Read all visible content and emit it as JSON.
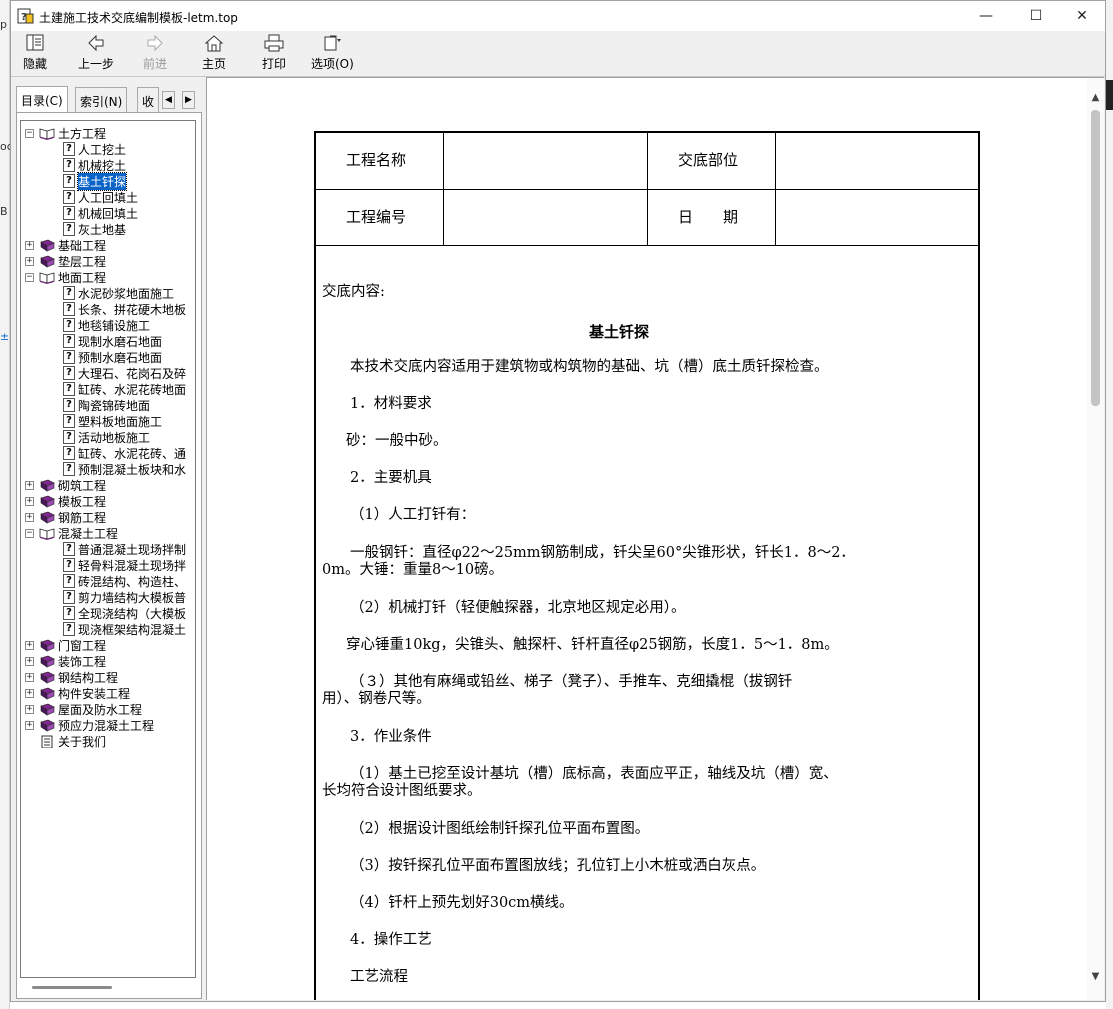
{
  "window": {
    "title": "土建施工技术交底编制模板-letm.top",
    "controls": {
      "minimize": "—",
      "maximize": "☐",
      "close": "✕"
    }
  },
  "toolbar": {
    "hide": "隐藏",
    "back": "上一步",
    "forward": "前进",
    "home": "主页",
    "print": "打印",
    "options": "选项(O)"
  },
  "nav_tabs": {
    "contents": "目录(C)",
    "index": "索引(N)",
    "favorites": "收"
  },
  "tree": [
    {
      "text": "土方工程",
      "type": "book-open",
      "level": 0,
      "expander": "−"
    },
    {
      "text": "人工挖土",
      "type": "page",
      "level": 1
    },
    {
      "text": "机械挖土",
      "type": "page",
      "level": 1
    },
    {
      "text": "基土钎探",
      "type": "page",
      "level": 1,
      "selected": true
    },
    {
      "text": "人工回填土",
      "type": "page",
      "level": 1
    },
    {
      "text": "机械回填土",
      "type": "page",
      "level": 1
    },
    {
      "text": "灰土地基",
      "type": "page",
      "level": 1
    },
    {
      "text": "基础工程",
      "type": "book",
      "level": 0,
      "expander": "+"
    },
    {
      "text": "垫层工程",
      "type": "book",
      "level": 0,
      "expander": "+"
    },
    {
      "text": "地面工程",
      "type": "book-open",
      "level": 0,
      "expander": "−"
    },
    {
      "text": "水泥砂浆地面施工",
      "type": "page",
      "level": 1
    },
    {
      "text": "长条、拼花硬木地板",
      "type": "page",
      "level": 1
    },
    {
      "text": "地毯铺设施工",
      "type": "page",
      "level": 1
    },
    {
      "text": "现制水磨石地面",
      "type": "page",
      "level": 1
    },
    {
      "text": "预制水磨石地面",
      "type": "page",
      "level": 1
    },
    {
      "text": "大理石、花岗石及碎",
      "type": "page",
      "level": 1
    },
    {
      "text": "缸砖、水泥花砖地面",
      "type": "page",
      "level": 1
    },
    {
      "text": "陶瓷锦砖地面",
      "type": "page",
      "level": 1
    },
    {
      "text": "塑料板地面施工",
      "type": "page",
      "level": 1
    },
    {
      "text": "活动地板施工",
      "type": "page",
      "level": 1
    },
    {
      "text": "缸砖、水泥花砖、通",
      "type": "page",
      "level": 1
    },
    {
      "text": "预制混凝土板块和水",
      "type": "page",
      "level": 1
    },
    {
      "text": "砌筑工程",
      "type": "book",
      "level": 0,
      "expander": "+"
    },
    {
      "text": "模板工程",
      "type": "book",
      "level": 0,
      "expander": "+"
    },
    {
      "text": "钢筋工程",
      "type": "book",
      "level": 0,
      "expander": "+"
    },
    {
      "text": "混凝土工程",
      "type": "book-open",
      "level": 0,
      "expander": "−"
    },
    {
      "text": "普通混凝土现场拌制",
      "type": "page",
      "level": 1
    },
    {
      "text": "轻骨料混凝土现场拌",
      "type": "page",
      "level": 1
    },
    {
      "text": "砖混结构、构造柱、",
      "type": "page",
      "level": 1
    },
    {
      "text": "剪力墙结构大模板普",
      "type": "page",
      "level": 1
    },
    {
      "text": "全现浇结构（大模板",
      "type": "page",
      "level": 1
    },
    {
      "text": "现浇框架结构混凝土",
      "type": "page",
      "level": 1
    },
    {
      "text": "门窗工程",
      "type": "book",
      "level": 0,
      "expander": "+"
    },
    {
      "text": "装饰工程",
      "type": "book",
      "level": 0,
      "expander": "+"
    },
    {
      "text": "钢结构工程",
      "type": "book",
      "level": 0,
      "expander": "+"
    },
    {
      "text": "构件安装工程",
      "type": "book",
      "level": 0,
      "expander": "+"
    },
    {
      "text": "屋面及防水工程",
      "type": "book",
      "level": 0,
      "expander": "+"
    },
    {
      "text": "预应力混凝土工程",
      "type": "book",
      "level": 0,
      "expander": "+"
    },
    {
      "text": "关于我们",
      "type": "doc",
      "level": 0
    }
  ],
  "doc": {
    "header": {
      "project_name_label": "工程名称",
      "location_label": "交底部位",
      "project_no_label": "工程编号",
      "date_label": "日　　期"
    },
    "intro_label": "交底内容:",
    "title": "基土钎探",
    "paragraphs": [
      "本技术交底内容适用于建筑物或构筑物的基础、坑（槽）底土质钎探检查。",
      "1．材料要求",
      "砂：一般中砂。",
      "2．主要机具",
      "（1）人工打钎有：",
      "一般钢钎：直径φ22～25mm钢筋制成，钎尖呈60°尖锥形状，钎长1．8～2．",
      "0m。大锤：重量8～10磅。",
      "（2）机械打钎（轻便触探器，北京地区规定必用）。",
      "穿心锤重10kg，尖锥头、触探杆、钎杆直径φ25钢筋，长度1．5～1．8m。",
      "（３）其他有麻绳或铅丝、梯子（凳子）、手推车、克细撬棍（拔钢钎",
      "用）、钢卷尺等。",
      "3．作业条件",
      "（1）基土已挖至设计基坑（槽）底标高，表面应平正，轴线及坑（槽）宽、",
      "长均符合设计图纸要求。",
      "（2）根据设计图纸绘制钎探孔位平面布置图。",
      "（3）按钎探孔位平面布置图放线；孔位钉上小木桩或洒白灰点。",
      "（4）钎杆上预先划好30cm横线。",
      "4．操作工艺",
      "工艺流程"
    ]
  },
  "colors": {
    "selection": "#0a64c8",
    "book_purple": "#7b2a8c"
  }
}
